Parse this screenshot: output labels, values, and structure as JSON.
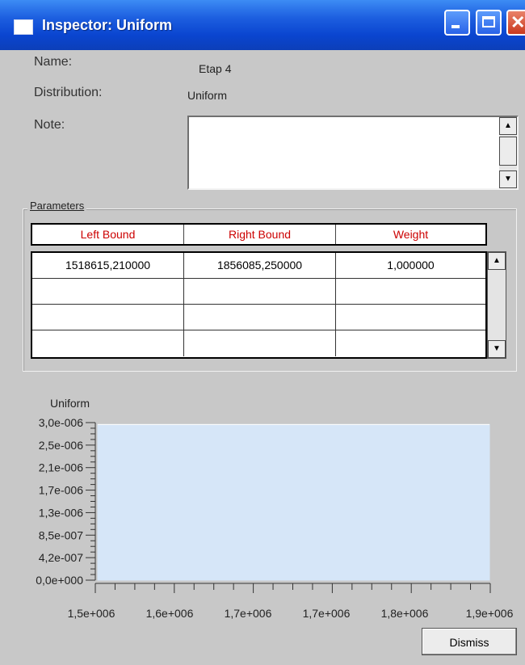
{
  "window": {
    "title": "Inspector: Uniform",
    "controls": {
      "minimize": "minimize-icon",
      "maximize": "maximize-icon",
      "close": "close-icon"
    }
  },
  "fields": {
    "name_label": "Name:",
    "name_value": "Etap 4",
    "distribution_label": "Distribution:",
    "distribution_value": "Uniform",
    "note_label": "Note:",
    "note_value": ""
  },
  "parameters": {
    "group_title": "Parameters",
    "columns": [
      "Left Bound",
      "Right Bound",
      "Weight"
    ],
    "rows": [
      [
        "1518615,210000",
        "1856085,250000",
        "1,000000"
      ],
      [
        "",
        "",
        ""
      ],
      [
        "",
        "",
        ""
      ],
      [
        "",
        "",
        ""
      ]
    ]
  },
  "chart_data": {
    "type": "area",
    "title": "Uniform",
    "y_ticks": [
      "3,0e-006",
      "2,5e-006",
      "2,1e-006",
      "1,7e-006",
      "1,3e-006",
      "8,5e-007",
      "4,2e-007",
      "0,0e+000"
    ],
    "x_ticks": [
      "1,5e+006",
      "1,6e+006",
      "1,7e+006",
      "1,7e+006",
      "1,8e+006",
      "1,9e+006"
    ],
    "x": [
      1518615.21,
      1856085.25
    ],
    "y": [
      2.963e-06,
      2.963e-06
    ],
    "ylim": [
      0,
      3e-06
    ],
    "fill_color": "#d6e6f8",
    "grid": false
  },
  "buttons": {
    "dismiss": "Dismiss"
  },
  "colors": {
    "titlebar": "#0a45d0",
    "header_text": "#cc0000",
    "window_bg": "#c8c8c8"
  }
}
